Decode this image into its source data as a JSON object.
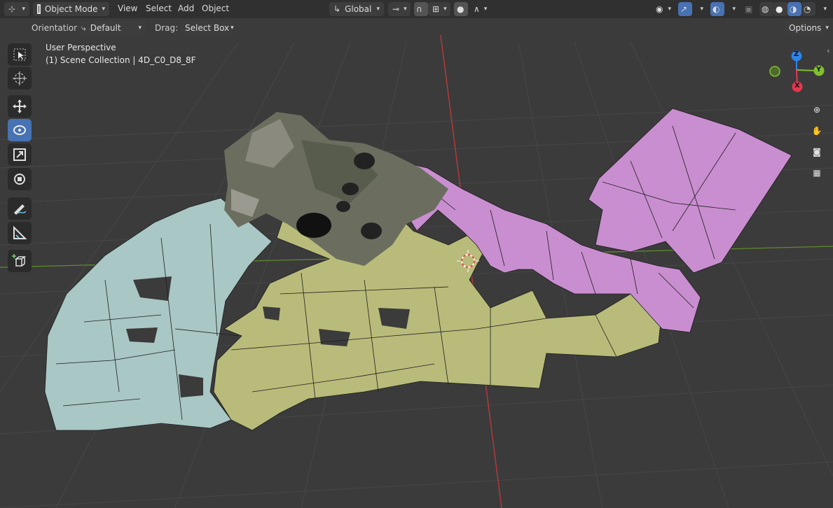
{
  "header": {
    "mode_label": "Object Mode",
    "menus": [
      "View",
      "Select",
      "Add",
      "Object"
    ],
    "transform_orientation": "Global"
  },
  "tool_settings": {
    "orientation_label": "Orientation:",
    "orientation_value": "Default",
    "drag_label": "Drag:",
    "drag_value": "Select Box",
    "options_label": "Options"
  },
  "viewport": {
    "view_name": "User Perspective",
    "collection_info": "(1) Scene Collection | 4D_C0_D8_8F"
  },
  "gizmo": {
    "z": "Z",
    "y": "Y",
    "x": "X"
  },
  "colors": {
    "header_bg": "#303030",
    "viewport_bg": "#3a3a3a",
    "active_tool": "#4772b3",
    "axis_x": "#e8364f",
    "axis_y": "#80c031",
    "axis_z": "#2d84e8",
    "mesh_blue": "#a9c7c4",
    "mesh_yellow": "#b9bb7a",
    "mesh_pink": "#c98ed0"
  },
  "tools": [
    "tweak-icon",
    "cursor-icon",
    "move-icon",
    "rotate-icon",
    "scale-icon",
    "transform-icon",
    "annotate-icon",
    "measure-icon",
    "add-cube-icon"
  ]
}
